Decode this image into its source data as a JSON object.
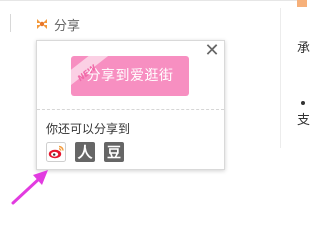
{
  "header": {
    "share_label": "分享"
  },
  "popup": {
    "close_glyph": "✕",
    "promo_text": "分享到爱逛街",
    "promo_badge": "NEW",
    "also_share_label": "你还可以分享到",
    "targets": [
      {
        "name": "weibo",
        "icon": "weibo-icon"
      },
      {
        "name": "renren",
        "icon": "renren-icon",
        "glyph": "人"
      },
      {
        "name": "douban",
        "icon": "douban-icon",
        "glyph": "豆"
      }
    ]
  },
  "side_content": {
    "text_1": "承",
    "text_2": "支"
  },
  "colors": {
    "promo_pink": "#f78fc1",
    "arrow_magenta": "#e23be0",
    "weibo_red": "#e6162d",
    "icon_gray": "#666666"
  }
}
